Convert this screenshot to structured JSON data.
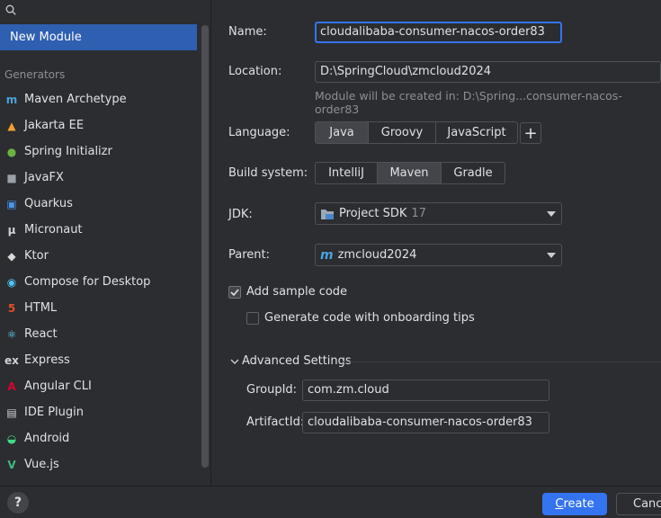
{
  "sidebar": {
    "selected": "New Module",
    "generators_label": "Generators",
    "generators": [
      {
        "label": "Maven Archetype",
        "icon": "maven-icon",
        "color": "#4aa3df"
      },
      {
        "label": "Jakarta EE",
        "icon": "jakarta-icon",
        "color": "#f0a030"
      },
      {
        "label": "Spring Initializr",
        "icon": "spring-icon",
        "color": "#6db33f"
      },
      {
        "label": "JavaFX",
        "icon": "folder-icon",
        "color": "#9aa0a6"
      },
      {
        "label": "Quarkus",
        "icon": "quarkus-icon",
        "color": "#4695eb"
      },
      {
        "label": "Micronaut",
        "icon": "micronaut-icon",
        "color": "#cfd2d6"
      },
      {
        "label": "Ktor",
        "icon": "ktor-icon",
        "color": "#d9d9d9"
      },
      {
        "label": "Compose for Desktop",
        "icon": "compose-icon",
        "color": "#4fc3f7"
      },
      {
        "label": "HTML",
        "icon": "html-icon",
        "color": "#e44d26"
      },
      {
        "label": "React",
        "icon": "react-icon",
        "color": "#61dafb"
      },
      {
        "label": "Express",
        "icon": "express-icon",
        "color": "#cfd2d6"
      },
      {
        "label": "Angular CLI",
        "icon": "angular-icon",
        "color": "#dd0031"
      },
      {
        "label": "IDE Plugin",
        "icon": "plugin-icon",
        "color": "#cfd2d6"
      },
      {
        "label": "Android",
        "icon": "android-icon",
        "color": "#3ddc84"
      },
      {
        "label": "Vue.js",
        "icon": "vue-icon",
        "color": "#41b883"
      }
    ]
  },
  "form": {
    "name_label": "Name:",
    "name_value": "cloudalibaba-consumer-nacos-order83",
    "location_label": "Location:",
    "location_value": "D:\\SpringCloud\\zmcloud2024",
    "location_hint": "Module will be created in: D:\\Spring...consumer-nacos-order83",
    "language_label": "Language:",
    "languages": [
      "Java",
      "Groovy",
      "JavaScript"
    ],
    "language_selected": "Java",
    "add_language": "+",
    "build_label": "Build system:",
    "builds": [
      "IntelliJ",
      "Maven",
      "Gradle"
    ],
    "build_selected": "Maven",
    "jdk_label": "JDK:",
    "jdk_value": "Project SDK",
    "jdk_version": "17",
    "parent_label": "Parent:",
    "parent_value": "zmcloud2024",
    "add_sample_label": "Add sample code",
    "add_sample_checked": true,
    "onboarding_label": "Generate code with onboarding tips",
    "onboarding_checked": false,
    "advanced_label": "Advanced Settings",
    "groupid_label": "GroupId:",
    "groupid_value": "com.zm.cloud",
    "artifactid_label": "ArtifactId:",
    "artifactid_value": "cloudalibaba-consumer-nacos-order83"
  },
  "footer": {
    "help": "?",
    "create_mnemonic": "C",
    "create_rest": "reate",
    "cancel": "Cance"
  },
  "colors": {
    "accent": "#3574f0",
    "selection": "#2e5fb0"
  }
}
